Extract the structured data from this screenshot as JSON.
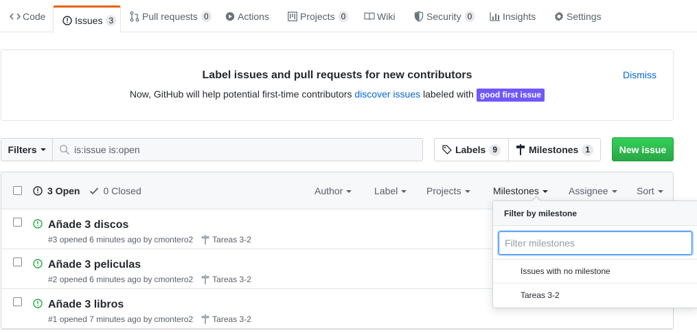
{
  "tabs": [
    {
      "label": "Code",
      "icon": "code-icon"
    },
    {
      "label": "Issues",
      "count": "3",
      "icon": "issue-opened-icon"
    },
    {
      "label": "Pull requests",
      "count": "0",
      "icon": "git-pull-request-icon"
    },
    {
      "label": "Actions",
      "icon": "play-icon"
    },
    {
      "label": "Projects",
      "count": "0",
      "icon": "project-icon"
    },
    {
      "label": "Wiki",
      "icon": "book-icon"
    },
    {
      "label": "Security",
      "count": "0",
      "icon": "shield-icon"
    },
    {
      "label": "Insights",
      "icon": "graph-icon"
    },
    {
      "label": "Settings",
      "icon": "gear-icon"
    }
  ],
  "banner": {
    "title": "Label issues and pull requests for new contributors",
    "text_before": "Now, GitHub will help potential first-time contributors ",
    "link": "discover issues",
    "text_after": " labeled with ",
    "label": "good first issue",
    "dismiss": "Dismiss"
  },
  "filter_bar": {
    "filters_label": "Filters",
    "search_value": "is:issue is:open",
    "labels_label": "Labels",
    "labels_count": "9",
    "milestones_label": "Milestones",
    "milestones_count": "1",
    "new_issue_label": "New issue"
  },
  "issues_header": {
    "open": "3 Open",
    "closed": "0 Closed",
    "menus": [
      "Author",
      "Label",
      "Projects",
      "Milestones",
      "Assignee",
      "Sort"
    ]
  },
  "issues": [
    {
      "title": "Añade 3 discos",
      "number": "#3",
      "opened": "opened 6 minutes ago by",
      "author": "cmontero2",
      "milestone": "Tareas 3-2"
    },
    {
      "title": "Añade 3 peliculas",
      "number": "#2",
      "opened": "opened 6 minutes ago by",
      "author": "cmontero2",
      "milestone": "Tareas 3-2"
    },
    {
      "title": "Añade 3 libros",
      "number": "#1",
      "opened": "opened 7 minutes ago by",
      "author": "cmontero2",
      "milestone": "Tareas 3-2"
    }
  ],
  "milestone_dropdown": {
    "title": "Filter by milestone",
    "placeholder": "Filter milestones",
    "items": [
      "Issues with no milestone",
      "Tareas 3-2"
    ]
  },
  "colors": {
    "accent_tab": "#e36209",
    "link": "#0366d6",
    "open_green": "#28a745",
    "good_first_issue": "#7057ff"
  }
}
